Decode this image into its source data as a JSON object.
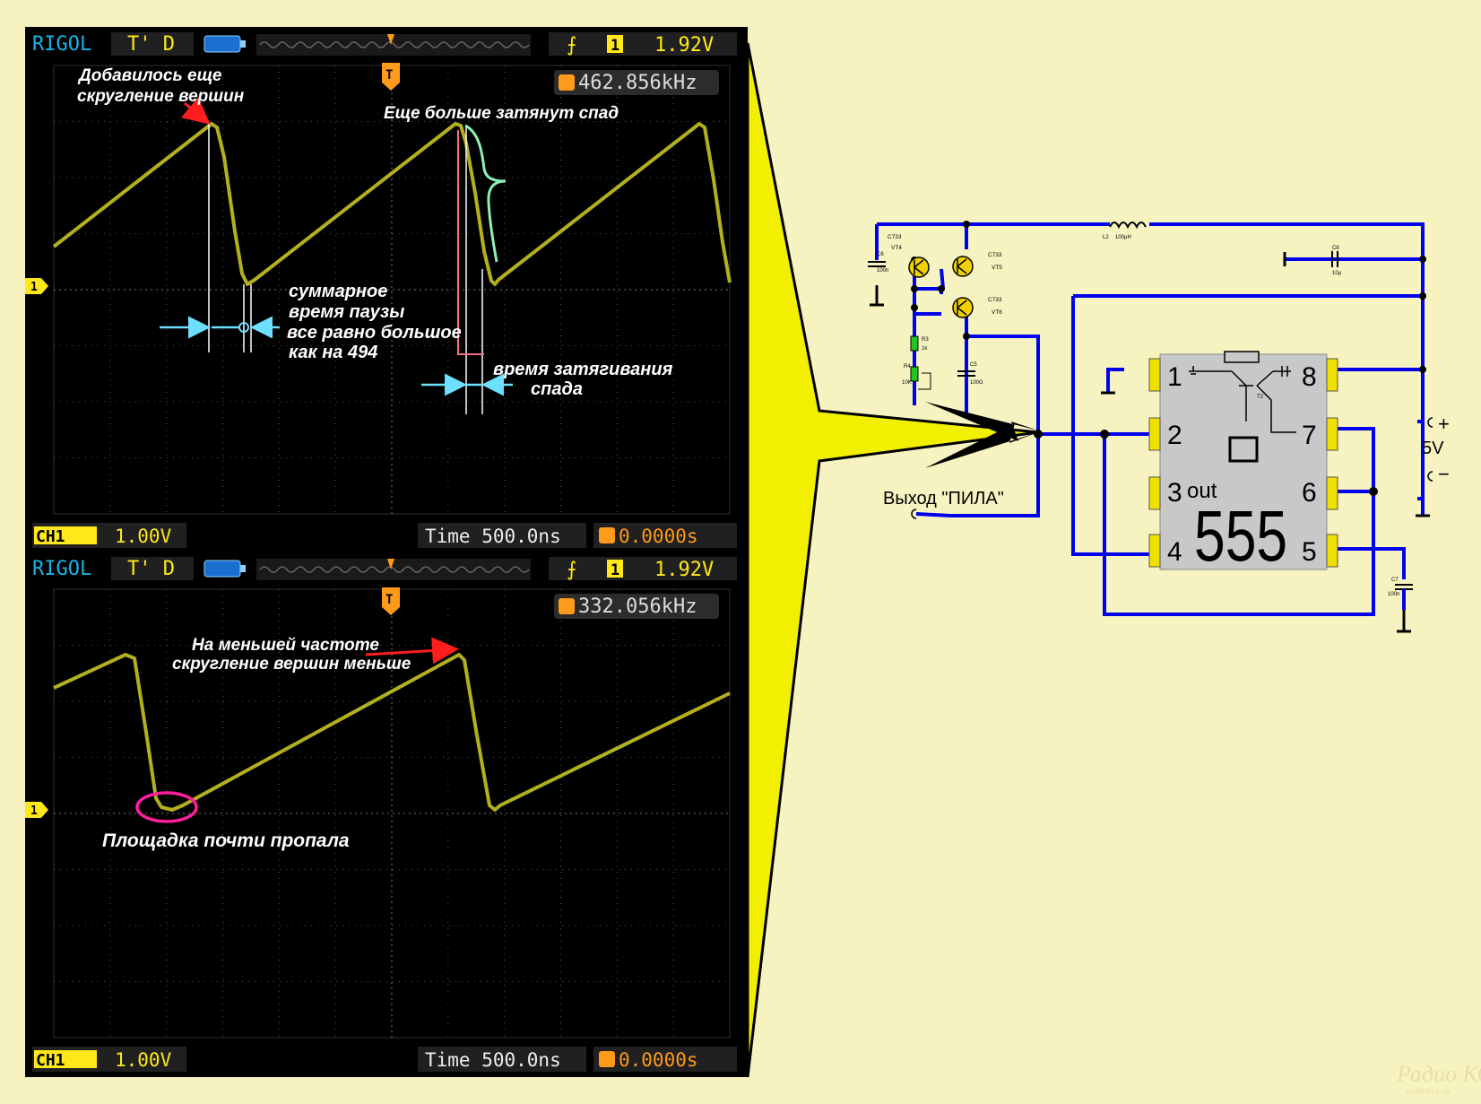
{
  "colors": {
    "background": "#f6f3c1",
    "screen": "#000000",
    "trace": "#b3b01d",
    "rigol_text": "#1ab2e6",
    "status_yellow": "#ffe81a",
    "wire": "#0000ee",
    "pin": "#f0e000",
    "chip": "#c8c8c8",
    "arrow_red": "#ff1e1e",
    "cyan_marker": "#6de0ff",
    "circle_magenta": "#ff1e9e",
    "pointer_fill": "#f2ef00",
    "resistor": "#22c422",
    "transistor": "#f0d000"
  },
  "scope_top": {
    "brand": "RIGOL",
    "status": "T' D",
    "trigger_voltage": "1.92V",
    "trigger_ch": "1",
    "frequency": "462.856kHz",
    "ch_label": "CH1",
    "ch_scale": "1.00V",
    "time_label": "Time 500.0ns",
    "offset": "0.0000s",
    "ch_marker": "1",
    "trig_marker": "T",
    "annotations": {
      "rounding_l1": "Добавилось еще",
      "rounding_l2": "скругление вершин",
      "decay": "Еще больше затянут спад",
      "pause_l1": "суммарное",
      "pause_l2": "время паузы",
      "pause_l3": "все равно большое",
      "pause_l4": "как на 494",
      "fall_l1": "время затягивания",
      "fall_l2": "спада"
    }
  },
  "scope_bottom": {
    "brand": "RIGOL",
    "status": "T' D",
    "trigger_voltage": "1.92V",
    "trigger_ch": "1",
    "frequency": "332.056kHz",
    "ch_label": "CH1",
    "ch_scale": "1.00V",
    "time_label": "Time 500.0ns",
    "offset": "0.0000s",
    "ch_marker": "1",
    "trig_marker": "T",
    "annotations": {
      "lowfreq_l1": "На меньшей частоте",
      "lowfreq_l2": "скругление вершин меньше",
      "plateau": "Площадка почти пропала"
    }
  },
  "schematic": {
    "ic_label": "555",
    "out_label": "out",
    "pins": [
      "1",
      "2",
      "3",
      "4",
      "5",
      "6",
      "7",
      "8"
    ],
    "output_label": "Выход \"ПИЛА\"",
    "supply_label": "5V",
    "plus": "+",
    "minus": "−",
    "components": {
      "c6": "C6",
      "c6_val": "100n",
      "vt4_type": "C733",
      "vt4": "VT4",
      "vt5_type": "C733",
      "vt5": "VT5",
      "vt6_type": "C733",
      "vt6": "VT6",
      "r3": "R3",
      "r3_val": "1k",
      "r4": "R4",
      "r4_val": "10K",
      "c5": "C5",
      "c5_val": "100G",
      "l2": "L2",
      "l2_val": "100μH",
      "c8": "C8",
      "c8_val": "10μ",
      "c7": "C7",
      "c7_val": "100n",
      "t2": "T2"
    }
  },
  "watermark": {
    "l1": "Радио КОТ",
    "l2": "radiokot.ru"
  }
}
